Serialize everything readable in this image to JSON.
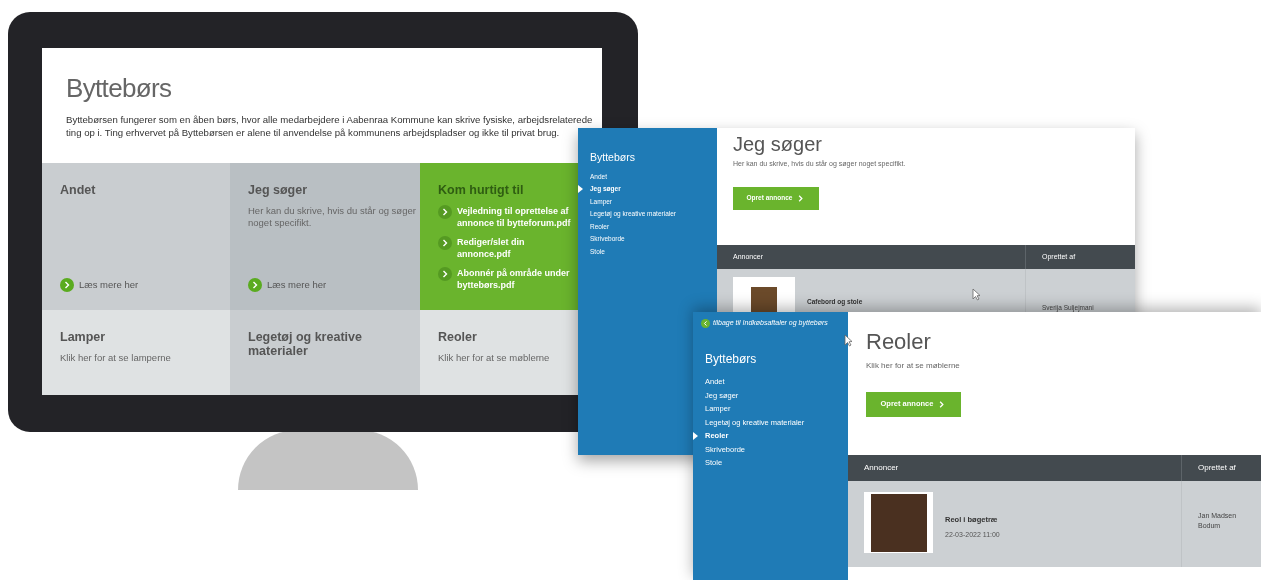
{
  "monitor_page": {
    "title": "Byttebørs",
    "intro": "Byttebørsen fungerer som en åben børs, hvor alle medarbejdere i Aabenraa Kommune kan skrive fysiske, arbejdsrelaterede ting op i. Ting erhvervet på Byttebørsen er alene til anvendelse på kommunens arbejdspladser og ikke til privat brug.",
    "tiles": [
      {
        "kind": "category",
        "title": "Andet",
        "link": "Læs mere her"
      },
      {
        "kind": "category",
        "title": "Jeg søger",
        "text": "Her kan du skrive, hvis du står og søger noget specifikt.",
        "link": "Læs mere her"
      },
      {
        "kind": "quick_links",
        "title": "Kom hurtigt til",
        "links": [
          "Vejledning til oprettelse af annonce til bytteforum.pdf",
          "Rediger/slet din annonce.pdf",
          "Abonnér på område under byttebørs.pdf"
        ]
      },
      {
        "kind": "category",
        "title": "Lamper",
        "text": "Klik her for at se lamperne"
      },
      {
        "kind": "category",
        "title": "Legetøj og kreative materialer"
      },
      {
        "kind": "category",
        "title": "Reoler",
        "text": "Klik her for at se møblerne"
      }
    ]
  },
  "screens": [
    {
      "sidebar": {
        "title": "Byttebørs",
        "items": [
          {
            "label": "Andet",
            "selected": false
          },
          {
            "label": "Jeg søger",
            "selected": true
          },
          {
            "label": "Lamper",
            "selected": false
          },
          {
            "label": "Legetøj og kreative materialer",
            "selected": false
          },
          {
            "label": "Reoler",
            "selected": false
          },
          {
            "label": "Skriveborde",
            "selected": false
          },
          {
            "label": "Stole",
            "selected": false
          }
        ]
      },
      "heading": "Jeg søger",
      "text": "Her kan du skrive, hvis du står og søger noget specifikt.",
      "button": "Opret annonce",
      "table": {
        "columns": [
          "Annoncer",
          "Oprettet af"
        ],
        "rows": [
          {
            "title": "Cafebord og stole",
            "author": "Sverija Suljejmani"
          }
        ]
      }
    },
    {
      "back_link": "tilbage til Indkøbsaftaler og byttebørs",
      "sidebar": {
        "title": "Byttebørs",
        "items": [
          {
            "label": "Andet",
            "selected": false
          },
          {
            "label": "Jeg søger",
            "selected": false
          },
          {
            "label": "Lamper",
            "selected": false
          },
          {
            "label": "Legetøj og kreative materialer",
            "selected": false
          },
          {
            "label": "Reoler",
            "selected": true
          },
          {
            "label": "Skriveborde",
            "selected": false
          },
          {
            "label": "Stole",
            "selected": false
          }
        ]
      },
      "heading": "Reoler",
      "text": "Klik her for at se møblerne",
      "button": "Opret annonce",
      "table": {
        "columns": [
          "Annoncer",
          "Oprettet af"
        ],
        "rows": [
          {
            "title": "Reol i bøgetræ",
            "date": "22-03-2022 11:00",
            "author": "Jan Madsen Bodum"
          }
        ]
      }
    }
  ]
}
